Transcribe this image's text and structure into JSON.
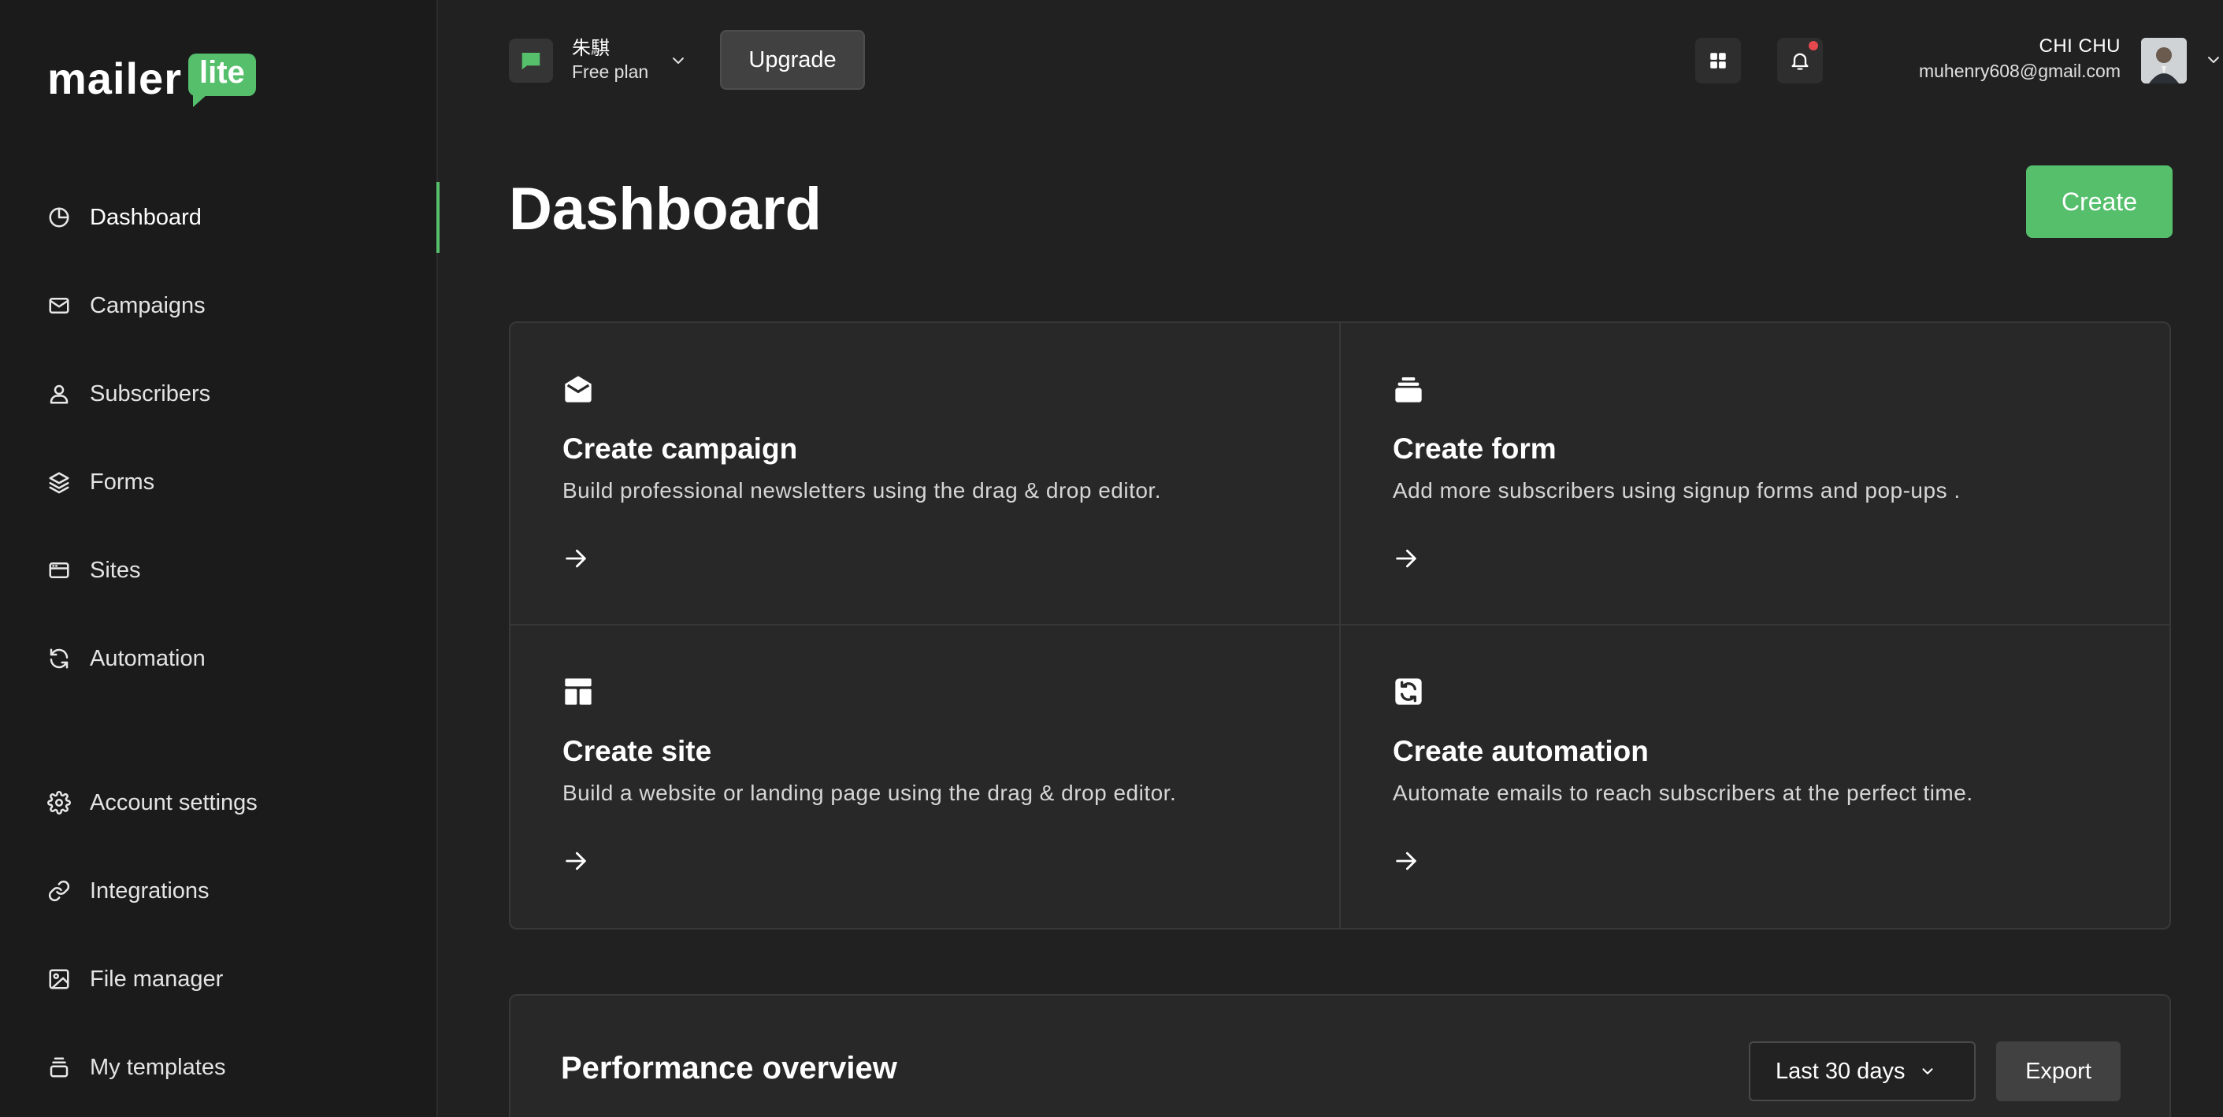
{
  "brand": {
    "word": "mailer",
    "badge": "lite",
    "accent": "#55bf6b"
  },
  "sidebar": {
    "items": [
      {
        "label": "Dashboard",
        "icon": "pie-chart-icon",
        "active": true
      },
      {
        "label": "Campaigns",
        "icon": "envelope-icon"
      },
      {
        "label": "Subscribers",
        "icon": "user-icon"
      },
      {
        "label": "Forms",
        "icon": "layers-icon"
      },
      {
        "label": "Sites",
        "icon": "browser-window-icon"
      },
      {
        "label": "Automation",
        "icon": "refresh-icon"
      }
    ],
    "bottom_items": [
      {
        "label": "Account settings",
        "icon": "gear-icon"
      },
      {
        "label": "Integrations",
        "icon": "link-icon"
      },
      {
        "label": "File manager",
        "icon": "image-icon"
      },
      {
        "label": "My templates",
        "icon": "template-stack-icon"
      }
    ]
  },
  "topbar": {
    "account_name": "朱騏",
    "account_plan": "Free plan",
    "upgrade_label": "Upgrade",
    "user_name": "CHI CHU",
    "user_email": "muhenry608@gmail.com"
  },
  "page": {
    "title": "Dashboard",
    "create_label": "Create"
  },
  "cards": [
    {
      "title": "Create campaign",
      "desc": "Build professional newsletters using the drag & drop editor.",
      "icon": "open-envelope-icon"
    },
    {
      "title": "Create form",
      "desc": "Add more subscribers using signup forms and pop-ups .",
      "icon": "form-stack-icon"
    },
    {
      "title": "Create site",
      "desc": "Build a website or landing page using the drag & drop editor.",
      "icon": "layout-icon"
    },
    {
      "title": "Create automation",
      "desc": "Automate emails to reach subscribers at the perfect time.",
      "icon": "automation-icon"
    }
  ],
  "performance": {
    "title": "Performance overview",
    "range_label": "Last 30 days",
    "export_label": "Export"
  }
}
